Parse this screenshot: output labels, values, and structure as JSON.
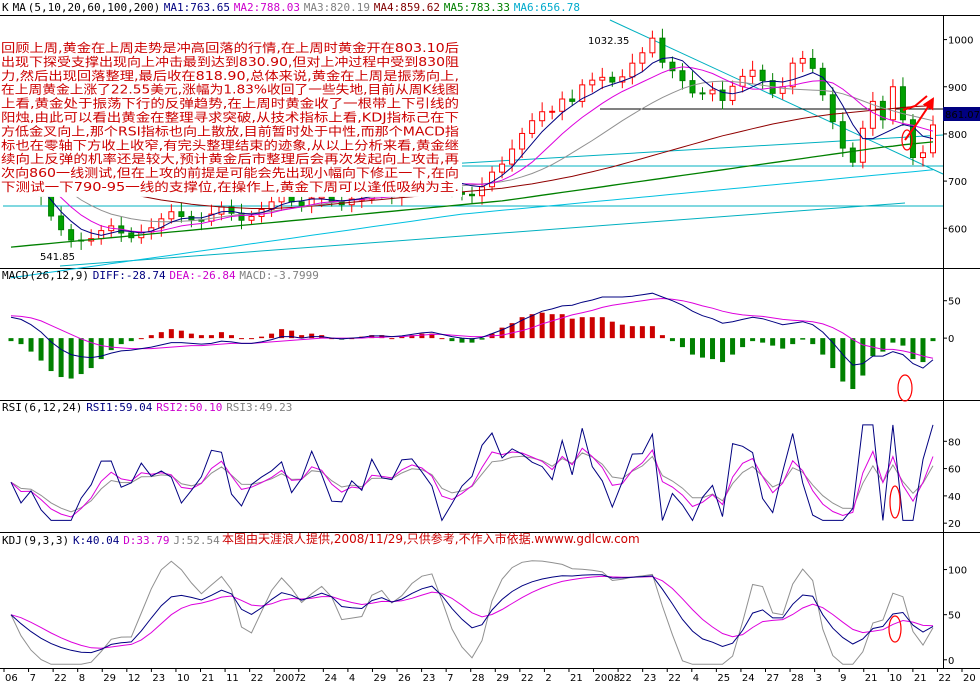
{
  "main_header": {
    "k_label": "K",
    "ma_label": "MA",
    "ma_params": "(5,10,20,60,100,200)",
    "items": [
      {
        "label": "MA1:763.65",
        "color": "#000080"
      },
      {
        "label": "MA2:788.03",
        "color": "#cc00cc"
      },
      {
        "label": "MA3:820.19",
        "color": "#808080"
      },
      {
        "label": "MA4:859.62",
        "color": "#800000"
      },
      {
        "label": "MA5:783.33",
        "color": "#008000"
      },
      {
        "label": "MA6:656.78",
        "color": "#00aacc"
      }
    ]
  },
  "commentary": [
    "回顾上周,黄金在上周走势是冲高回落的行情,在上周时黄金开在803.10后",
    "出现下探受支撑出现向上冲击最到达到830.90,但对上冲过程中受到830阻",
    "力,然后出现回落整理,最后收在818.90,总体来说,黄金在上周是振荡向上,",
    "在上周黄金上涨了22.55美元,涨幅为1.83%收回了一些失地,目前从周K线图",
    "上看,黄金处于振荡下行的反弹趋势,在上周时黄金收了一根带上下引线的",
    "阳烛,由此可以看出黄金在整理寻求突破,从技术指标上看,KDJ指标己在下",
    "方低金叉向上,那个RSI指标也向上散放,目前暂时处于中性,而那个MACD指",
    "标也在零轴下方收上收窄,有完头整理结束的迹象,从以上分析来看,黄金继",
    "续向上反弹的机率还是较大,预计黄金后市整理后会再次发起向上攻击,再",
    "次向860一线测试,但在上攻的前提是可能会先出现小幅向下修正一下,在向",
    "下测试一下790-95一线的支撑位,在操作上,黄金下周可以逢低吸纳为主."
  ],
  "price_labels": {
    "high": "1032.35",
    "low": "541.85",
    "current": "861.07"
  },
  "macd_header": {
    "name": "MACD",
    "params": "(26,12,9)",
    "items": [
      {
        "label": "DIFF:-28.74",
        "color": "#000080"
      },
      {
        "label": "DEA:-26.84",
        "color": "#cc00cc"
      },
      {
        "label": "MACD:-3.7999",
        "color": "#808080"
      }
    ]
  },
  "rsi_header": {
    "name": "RSI",
    "params": "(6,12,24)",
    "items": [
      {
        "label": "RSI1:59.04",
        "color": "#000080"
      },
      {
        "label": "RSI2:50.10",
        "color": "#cc00cc"
      },
      {
        "label": "RSI3:49.23",
        "color": "#808080"
      }
    ]
  },
  "kdj_header": {
    "name": "KDJ",
    "params": "(9,3,3)",
    "items": [
      {
        "label": "K:40.04",
        "color": "#000080"
      },
      {
        "label": "D:33.79",
        "color": "#cc00cc"
      },
      {
        "label": "J:52.54",
        "color": "#808080"
      }
    ]
  },
  "kdj_note": "本图由天涯浪人提供,2008/11/29,只供参考,不作入市依据.wwww.gdlcw.com",
  "chart_data": {
    "type": "candlestick-weekly",
    "panels": {
      "price": {
        "yticks": [
          600,
          700,
          800,
          900,
          1000
        ],
        "ylim": [
          520,
          1050
        ]
      },
      "macd": {
        "yticks": [
          0,
          50
        ],
        "ylim": [
          -80,
          75
        ]
      },
      "rsi": {
        "yticks": [
          20,
          40,
          60,
          80
        ],
        "ylim": [
          15,
          100
        ]
      },
      "kdj": {
        "yticks": [
          0,
          50,
          100
        ],
        "ylim": [
          -8,
          125
        ]
      }
    },
    "x_ticks": [
      "06",
      "7",
      "22",
      "8",
      "29",
      "12",
      "23",
      "10",
      "21",
      "11",
      "22",
      "2007",
      "2",
      "24",
      "4",
      "29",
      "26",
      "23",
      "7",
      "28",
      "29",
      "22",
      "2",
      "21",
      "2008",
      "22",
      "23",
      "22",
      "4",
      "25",
      "24",
      "27",
      "28",
      "3",
      "9",
      "21",
      "10",
      "21",
      "22",
      "20"
    ],
    "close": [
      742,
      718,
      700,
      668,
      626,
      597,
      575,
      573,
      578,
      595,
      605,
      590,
      580,
      592,
      601,
      620,
      635,
      625,
      618,
      615,
      630,
      645,
      632,
      617,
      625,
      640,
      656,
      672,
      656,
      648,
      664,
      667,
      656,
      650,
      662,
      662,
      680,
      676,
      667,
      676,
      692,
      705,
      712,
      687,
      676,
      672,
      669,
      688,
      719,
      736,
      768,
      801,
      828,
      847,
      848,
      874,
      869,
      904,
      914,
      920,
      910,
      921,
      950,
      972,
      1003,
      952,
      934,
      913,
      887,
      885,
      893,
      871,
      901,
      922,
      935,
      913,
      886,
      900,
      950,
      960,
      939,
      883,
      826,
      770,
      740,
      812,
      869,
      830,
      900,
      830,
      750,
      760,
      819
    ],
    "ma5": [
      730,
      720,
      705,
      685,
      660,
      635,
      615,
      598,
      590,
      585,
      590,
      595,
      593,
      590,
      594,
      602,
      613,
      620,
      622,
      622,
      628,
      635,
      636,
      632,
      630,
      633,
      640,
      650,
      656,
      658,
      662,
      662,
      660,
      658,
      660,
      663,
      668,
      670,
      670,
      675,
      682,
      690,
      698,
      700,
      698,
      695,
      690,
      688,
      698,
      712,
      730,
      755,
      780,
      805,
      825,
      845,
      860,
      875,
      885,
      898,
      905,
      912,
      920,
      932,
      950,
      960,
      962,
      955,
      935,
      915,
      898,
      888,
      885,
      890,
      900,
      910,
      912,
      910,
      915,
      922,
      930,
      920,
      895,
      860,
      820,
      790,
      790,
      800,
      810,
      820,
      815,
      795,
      790
    ],
    "ma10": [
      738,
      730,
      720,
      705,
      685,
      665,
      645,
      628,
      615,
      605,
      600,
      598,
      594,
      592,
      592,
      595,
      600,
      605,
      608,
      610,
      615,
      620,
      625,
      627,
      628,
      630,
      633,
      638,
      642,
      646,
      650,
      654,
      656,
      658,
      660,
      661,
      663,
      665,
      667,
      670,
      675,
      680,
      686,
      690,
      692,
      694,
      694,
      693,
      696,
      702,
      712,
      725,
      740,
      760,
      780,
      800,
      818,
      835,
      850,
      865,
      878,
      890,
      900,
      910,
      920,
      930,
      938,
      942,
      940,
      935,
      928,
      918,
      908,
      900,
      895,
      895,
      898,
      900,
      903,
      908,
      912,
      913,
      908,
      895,
      878,
      860,
      845,
      835,
      828,
      822,
      818,
      812,
      806
    ],
    "ma20": [
      745,
      740,
      732,
      720,
      706,
      690,
      675,
      660,
      648,
      638,
      630,
      625,
      620,
      617,
      615,
      614,
      614,
      615,
      616,
      618,
      621,
      624,
      627,
      630,
      632,
      634,
      636,
      639,
      642,
      645,
      648,
      651,
      654,
      657,
      660,
      663,
      666,
      668,
      670,
      672,
      675,
      678,
      681,
      684,
      687,
      690,
      692,
      694,
      696,
      699,
      703,
      709,
      716,
      725,
      735,
      747,
      760,
      773,
      786,
      800,
      814,
      828,
      841,
      854,
      866,
      877,
      887,
      896,
      903,
      908,
      911,
      912,
      911,
      909,
      906,
      903,
      900,
      897,
      895,
      894,
      893,
      892,
      890,
      885,
      878,
      870,
      862,
      855,
      849,
      843,
      838,
      833,
      828
    ],
    "ma60": [
      720,
      716,
      712,
      708,
      704,
      700,
      696,
      692,
      688,
      684,
      680,
      676,
      672,
      668,
      664,
      660,
      657,
      654,
      651,
      649,
      647,
      645,
      644,
      643,
      642,
      642,
      642,
      643,
      644,
      645,
      647,
      649,
      651,
      653,
      655,
      657,
      659,
      661,
      663,
      665,
      667,
      669,
      671,
      673,
      675,
      677,
      679,
      681,
      683,
      685,
      688,
      691,
      694,
      698,
      702,
      706,
      710,
      715,
      720,
      725,
      730,
      736,
      742,
      748,
      754,
      760,
      766,
      772,
      778,
      784,
      790,
      796,
      801,
      806,
      811,
      816,
      821,
      825,
      829,
      833,
      836,
      839,
      842,
      844,
      846,
      848,
      850,
      852,
      854,
      856,
      858,
      859,
      860
    ],
    "ma100": [
      560,
      562,
      564,
      566,
      568,
      570,
      572,
      574,
      576,
      578,
      580,
      582,
      584,
      586,
      588,
      590,
      592,
      594,
      596,
      598,
      600,
      602,
      604,
      606,
      608,
      610,
      612,
      614,
      616,
      618,
      620,
      622,
      624,
      626,
      628,
      630,
      632,
      634,
      636,
      638,
      640,
      642,
      644,
      646,
      648,
      650,
      652,
      654,
      656,
      658,
      661,
      664,
      667,
      670,
      673,
      676,
      679,
      682,
      685,
      688,
      691,
      694,
      697,
      700,
      703,
      706,
      709,
      712,
      715,
      718,
      721,
      724,
      727,
      730,
      733,
      736,
      739,
      742,
      745,
      748,
      751,
      754,
      757,
      760,
      763,
      766,
      769,
      772,
      774,
      777,
      779,
      781,
      783
    ],
    "ma200": [
      495,
      498,
      501,
      504,
      507,
      510,
      513,
      516,
      519,
      522,
      525,
      528,
      531,
      534,
      537,
      540,
      543,
      546,
      549,
      552,
      555,
      558,
      561,
      564,
      567,
      570,
      573,
      576,
      579,
      582,
      585,
      588,
      591,
      594,
      597,
      600,
      603,
      606,
      609,
      612,
      615,
      618,
      621,
      624,
      627,
      630,
      632,
      634,
      636,
      638,
      640,
      642,
      644,
      646,
      648,
      650,
      652,
      654,
      656,
      658,
      660,
      662,
      664,
      666,
      668,
      670,
      672,
      674,
      676,
      678,
      680,
      682,
      684,
      686,
      688,
      690,
      692,
      694,
      696,
      698,
      700,
      702,
      704,
      706,
      708,
      710,
      712,
      714,
      716,
      718,
      720,
      722,
      724
    ],
    "diff": [
      28,
      25,
      18,
      8,
      -5,
      -15,
      -22,
      -25,
      -26,
      -24,
      -20,
      -17,
      -16,
      -14,
      -12,
      -9,
      -6,
      -6,
      -7,
      -8,
      -7,
      -4,
      -5,
      -7,
      -7,
      -5,
      -2,
      2,
      2,
      0,
      2,
      2,
      0,
      -1,
      0,
      1,
      3,
      3,
      2,
      3,
      5,
      7,
      8,
      5,
      2,
      0,
      -1,
      1,
      6,
      11,
      17,
      24,
      30,
      36,
      39,
      43,
      44,
      48,
      51,
      55,
      55,
      55,
      56,
      58,
      60,
      55,
      50,
      44,
      36,
      30,
      26,
      20,
      22,
      25,
      28,
      26,
      22,
      18,
      20,
      22,
      18,
      8,
      -6,
      -22,
      -36,
      -34,
      -24,
      -24,
      -18,
      -22,
      -34,
      -40,
      -29
    ],
    "dea": [
      30,
      29,
      27,
      23,
      17,
      11,
      5,
      -1,
      -6,
      -10,
      -12,
      -13,
      -14,
      -14,
      -14,
      -13,
      -12,
      -11,
      -10,
      -10,
      -9,
      -8,
      -7,
      -7,
      -7,
      -6,
      -5,
      -4,
      -3,
      -2,
      -1,
      0,
      0,
      0,
      0,
      0,
      1,
      1,
      2,
      2,
      3,
      4,
      5,
      5,
      4,
      3,
      2,
      2,
      3,
      4,
      7,
      10,
      14,
      19,
      23,
      27,
      31,
      34,
      37,
      41,
      44,
      46,
      48,
      50,
      52,
      53,
      52,
      50,
      47,
      43,
      40,
      36,
      33,
      31,
      30,
      29,
      27,
      25,
      24,
      23,
      22,
      19,
      14,
      7,
      -2,
      -9,
      -12,
      -15,
      -15,
      -17,
      -20,
      -24,
      -27
    ]
  }
}
